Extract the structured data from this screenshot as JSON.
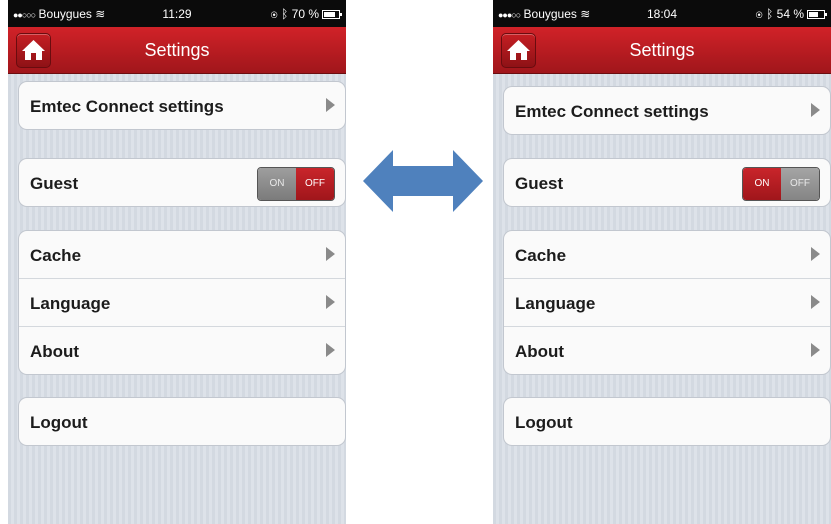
{
  "left": {
    "status": {
      "carrier": "Bouygues",
      "time": "11:29",
      "battery": "70 %",
      "battery_level": 0.7
    },
    "nav_title": "Settings",
    "emtec_label": "Emtec Connect settings",
    "guest": {
      "label": "Guest",
      "on_label": "ON",
      "off_label": "OFF",
      "state": "off"
    },
    "cache_label": "Cache",
    "language_label": "Language",
    "about_label": "About",
    "logout_label": "Logout"
  },
  "right": {
    "status": {
      "carrier": "Bouygues",
      "time": "18:04",
      "battery": "54 %",
      "battery_level": 0.54
    },
    "nav_title": "Settings",
    "emtec_label": "Emtec Connect settings",
    "guest": {
      "label": "Guest",
      "on_label": "ON",
      "off_label": "OFF",
      "state": "on"
    },
    "cache_label": "Cache",
    "language_label": "Language",
    "about_label": "About",
    "logout_label": "Logout"
  },
  "colors": {
    "accent": "#c41e24",
    "arrow": "#4f81bd"
  },
  "icons": {
    "home": "home-icon",
    "arrow": "double-arrow-icon"
  }
}
